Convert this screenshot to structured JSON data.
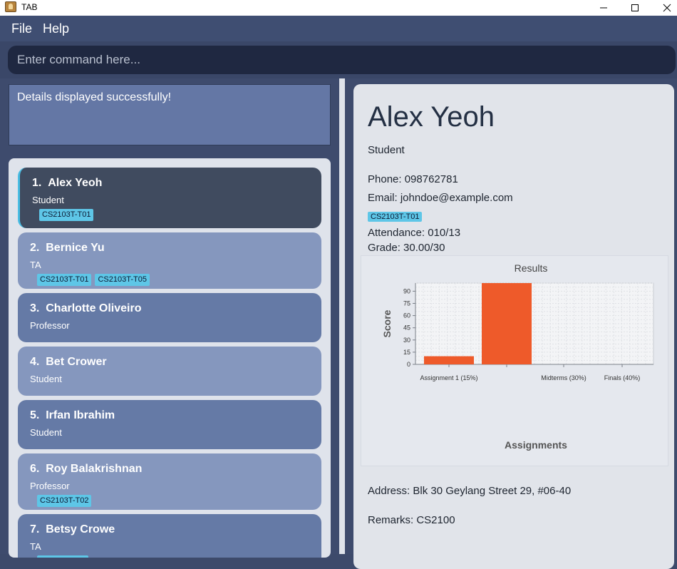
{
  "window": {
    "title": "TAB"
  },
  "menu": {
    "file": "File",
    "help": "Help"
  },
  "command": {
    "placeholder": "Enter command here..."
  },
  "result": {
    "message": "Details displayed successfully!"
  },
  "persons": [
    {
      "index": "1.",
      "name": "Alex Yeoh",
      "role": "Student",
      "tags": [
        "CS2103T-T01"
      ]
    },
    {
      "index": "2.",
      "name": "Bernice Yu",
      "role": "TA",
      "tags": [
        "CS2103T-T01",
        "CS2103T-T05"
      ]
    },
    {
      "index": "3.",
      "name": "Charlotte Oliveiro",
      "role": "Professor",
      "tags": []
    },
    {
      "index": "4.",
      "name": "Bet Crower",
      "role": "Student",
      "tags": []
    },
    {
      "index": "5.",
      "name": "Irfan Ibrahim",
      "role": "Student",
      "tags": []
    },
    {
      "index": "6.",
      "name": "Roy Balakrishnan",
      "role": "Professor",
      "tags": [
        "CS2103T-T02"
      ]
    },
    {
      "index": "7.",
      "name": "Betsy Crowe",
      "role": "TA",
      "tags": []
    }
  ],
  "details": {
    "name": "Alex Yeoh",
    "role": "Student",
    "phone": "Phone: 098762781",
    "email": "Email: johndoe@example.com",
    "tag": "CS2103T-T01",
    "attendance": "Attendance: 010/13",
    "grade": "Grade: 30.00/30",
    "address": "Address: Blk 30 Geylang Street 29, #06-40",
    "remarks": "Remarks: CS2100"
  },
  "colors": {
    "accent": "#49bde3",
    "bar": "#ee5a2a",
    "tag": "#5ec6e7"
  },
  "chart_data": {
    "type": "bar",
    "title": "Results",
    "xlabel": "Assignments",
    "ylabel": "Score",
    "categories": [
      "Assignment 1 (15%)",
      "",
      "Midterms (30%)",
      "Finals (40%)"
    ],
    "values": [
      10,
      100,
      0,
      0
    ],
    "ylim": [
      0,
      100
    ],
    "yticks": [
      0,
      15,
      30,
      45,
      60,
      75,
      90
    ],
    "grid": true
  }
}
